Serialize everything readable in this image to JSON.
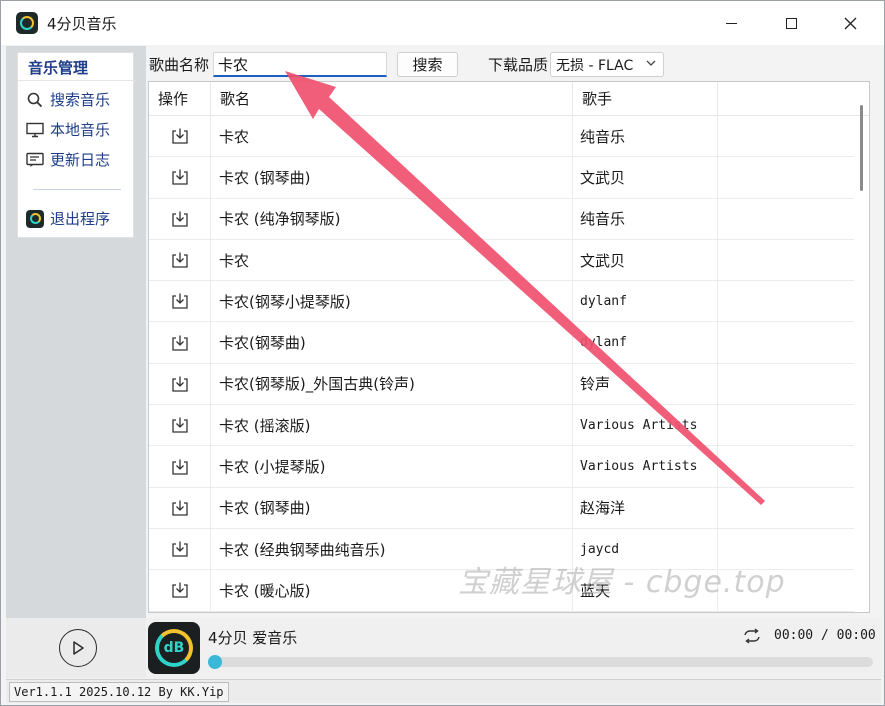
{
  "app": {
    "title": "4分贝音乐",
    "icon": "app-logo-icon"
  },
  "window_controls": {
    "minimize": "minimize-icon",
    "maximize": "maximize-icon",
    "close": "close-icon"
  },
  "sidebar": {
    "header": "音乐管理",
    "items": [
      {
        "label": "搜索音乐",
        "icon": "search-icon"
      },
      {
        "label": "本地音乐",
        "icon": "monitor-icon"
      },
      {
        "label": "更新日志",
        "icon": "log-icon"
      }
    ],
    "exit_label": "退出程序"
  },
  "search": {
    "label": "歌曲名称",
    "value": "卡农",
    "button": "搜索"
  },
  "quality": {
    "label": "下载品质",
    "selected": "无损 - FLAC"
  },
  "table": {
    "headers": [
      "操作",
      "歌名",
      "歌手",
      ""
    ],
    "rows": [
      {
        "title": "卡农",
        "artist": "纯音乐"
      },
      {
        "title": "卡农 (钢琴曲)",
        "artist": "文武贝"
      },
      {
        "title": "卡农 (纯净钢琴版)",
        "artist": "纯音乐"
      },
      {
        "title": "卡农",
        "artist": "文武贝"
      },
      {
        "title": "卡农(钢琴小提琴版)",
        "artist": "dylanf"
      },
      {
        "title": "卡农(钢琴曲)",
        "artist": "dylanf"
      },
      {
        "title": "卡农(钢琴版)_外国古典(铃声)",
        "artist": "铃声"
      },
      {
        "title": "卡农 (摇滚版)",
        "artist": "Various Artists"
      },
      {
        "title": "卡农 (小提琴版)",
        "artist": "Various Artists"
      },
      {
        "title": "卡农 (钢琴曲)",
        "artist": "赵海洋"
      },
      {
        "title": "卡农 (经典钢琴曲纯音乐)",
        "artist": "jaycd"
      },
      {
        "title": "卡农 (暖心版)",
        "artist": "蓝天"
      }
    ]
  },
  "player": {
    "now_playing": "4分贝 爱音乐",
    "time": "00:00 / 00:00",
    "progress": 0,
    "album_badge": "dB"
  },
  "status": {
    "version": "Ver1.1.1 2025.10.12 By KK.Yip"
  },
  "watermark": "宝藏星球屋 - cbge.top",
  "colors": {
    "accent": "#1f3d8a",
    "arrow": "#f0506e",
    "progress_knob": "#3ab8d8"
  }
}
